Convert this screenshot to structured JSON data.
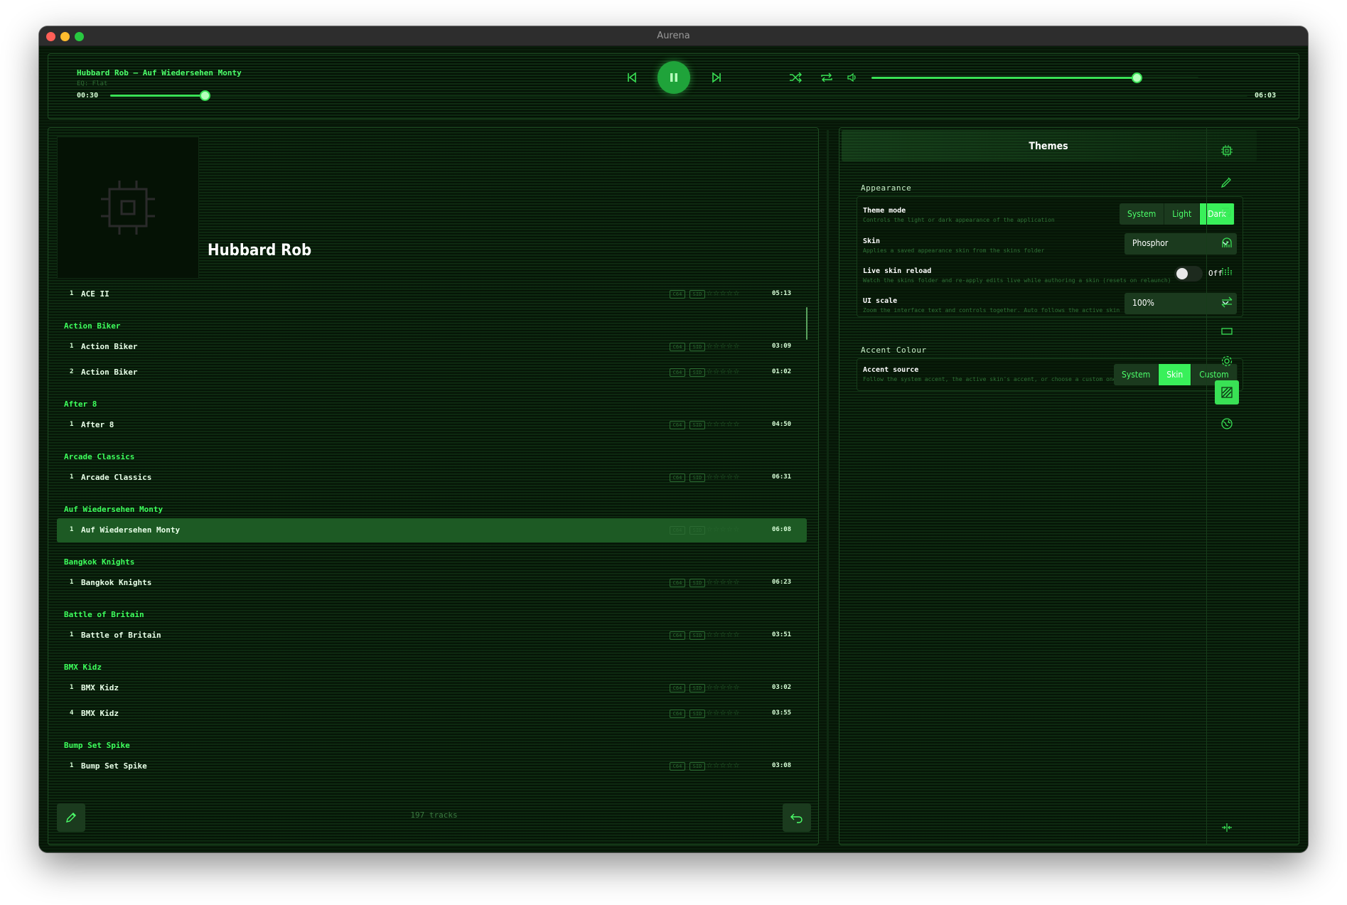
{
  "window": {
    "title": "Aurena"
  },
  "player": {
    "title": "Hubbard Rob – Auf Wiedersehen Monty",
    "eq": "EQ: Flat",
    "elapsed": "00:30",
    "total": "06:03",
    "progress": 0.083,
    "volume": 0.81
  },
  "library": {
    "artist": "Hubbard Rob",
    "count": "197 tracks",
    "partial_group_label": "ACE II",
    "groups": [
      {
        "name": "",
        "tracks": [
          {
            "num": "1",
            "title": "ACE II",
            "dur": "05:13"
          }
        ]
      },
      {
        "name": "Action Biker",
        "tracks": [
          {
            "num": "1",
            "title": "Action Biker",
            "dur": "03:09"
          },
          {
            "num": "2",
            "title": "Action Biker",
            "dur": "01:02"
          }
        ]
      },
      {
        "name": "After 8",
        "tracks": [
          {
            "num": "1",
            "title": "After 8",
            "dur": "04:50"
          }
        ]
      },
      {
        "name": "Arcade Classics",
        "tracks": [
          {
            "num": "1",
            "title": "Arcade Classics",
            "dur": "06:31"
          }
        ]
      },
      {
        "name": "Auf Wiedersehen Monty",
        "tracks": [
          {
            "num": "1",
            "title": "Auf Wiedersehen Monty",
            "dur": "06:08",
            "active": true
          }
        ]
      },
      {
        "name": "Bangkok Knights",
        "tracks": [
          {
            "num": "1",
            "title": "Bangkok Knights",
            "dur": "06:23"
          }
        ]
      },
      {
        "name": "Battle of Britain",
        "tracks": [
          {
            "num": "1",
            "title": "Battle of Britain",
            "dur": "03:51"
          }
        ]
      },
      {
        "name": "BMX Kidz",
        "tracks": [
          {
            "num": "1",
            "title": "BMX Kidz",
            "dur": "03:02"
          },
          {
            "num": "4",
            "title": "BMX Kidz",
            "dur": "03:55"
          }
        ]
      },
      {
        "name": "Bump Set Spike",
        "tracks": [
          {
            "num": "1",
            "title": "Bump Set Spike",
            "dur": "03:08"
          }
        ]
      }
    ],
    "badge1": "C64",
    "badge2": "SID"
  },
  "settings": {
    "heading": "Themes",
    "appearance": {
      "title": "Appearance",
      "theme_mode": {
        "label": "Theme mode",
        "desc": "Controls the light or dark appearance of the application",
        "options": [
          "System",
          "Light",
          "Dark"
        ],
        "selected": "Dark"
      },
      "skin": {
        "label": "Skin",
        "desc": "Applies a saved appearance skin from the skins folder",
        "value": "Phosphor"
      },
      "live_reload": {
        "label": "Live skin reload",
        "desc": "Watch the skins folder and re-apply edits live while authoring a skin (resets on relaunch)",
        "state": "Off"
      },
      "ui_scale": {
        "label": "UI scale",
        "desc": "Zoom the interface text and controls together. Auto follows the active skin",
        "value": "100%"
      }
    },
    "accent": {
      "title": "Accent Colour",
      "source": {
        "label": "Accent source",
        "desc": "Follow the system accent, the active skin's accent, or choose a custom one",
        "options": [
          "System",
          "Skin",
          "Custom"
        ],
        "selected": "Skin"
      }
    }
  },
  "sidebar_icons": [
    "chip-icon",
    "brush-icon",
    "playlist-icon",
    "visualizer-icon",
    "equalizer-icon",
    "transfer-icon",
    "display-icon",
    "settings-icon",
    "themes-icon",
    "globe-icon",
    "collapse-icon"
  ],
  "colors": {
    "accent": "#39e155",
    "active_row": "#1d5a24",
    "bg": "#061506"
  }
}
